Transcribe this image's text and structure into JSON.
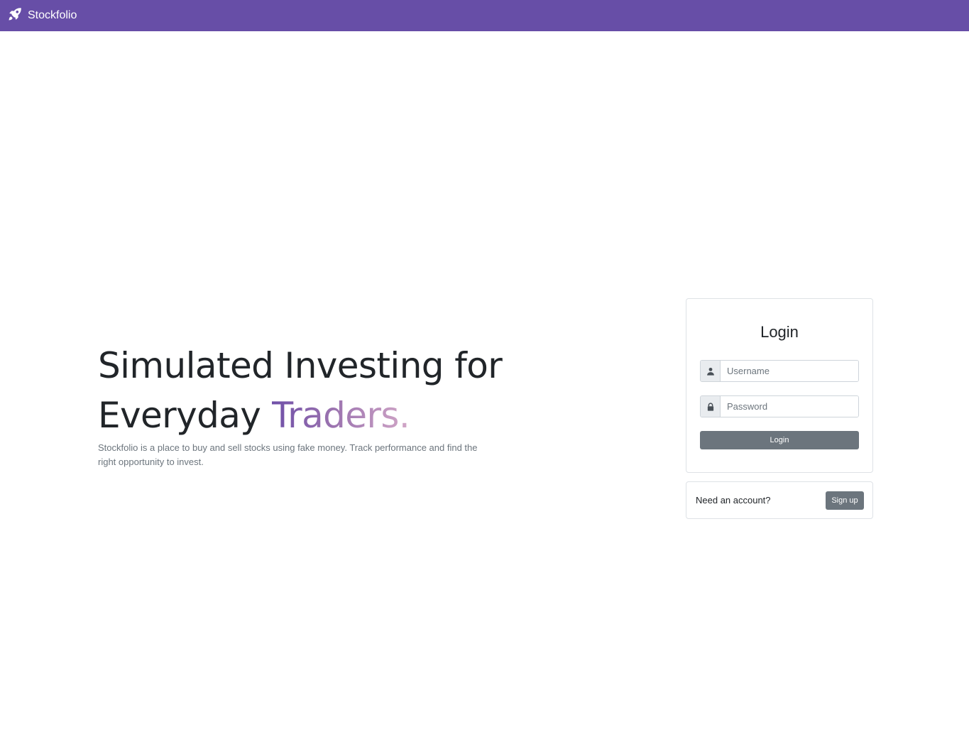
{
  "colors": {
    "brand": "#674ea7",
    "accent_start": "#6f4fa8",
    "accent_end": "#d2a7c7",
    "secondary_button": "#6c757d"
  },
  "navbar": {
    "brand_icon": "rocket-icon",
    "brand_name": "Stockfolio"
  },
  "hero": {
    "headline_line1": "Simulated Investing for",
    "headline_line2_prefix": "Everyday ",
    "headline_accent": "Traders.",
    "description": "Stockfolio is a place to buy and sell stocks using fake money. Track performance and find the right opportunity to invest."
  },
  "login": {
    "title": "Login",
    "username": {
      "icon": "user-icon",
      "placeholder": "Username",
      "value": ""
    },
    "password": {
      "icon": "lock-icon",
      "placeholder": "Password",
      "value": ""
    },
    "submit_label": "Login"
  },
  "signup": {
    "prompt": "Need an account?",
    "button_label": "Sign up"
  }
}
